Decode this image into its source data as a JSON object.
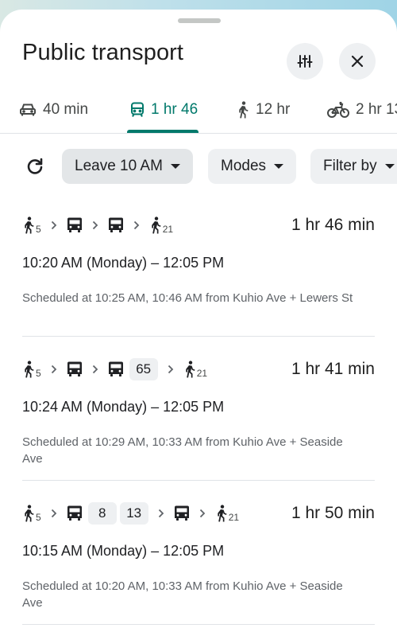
{
  "header": {
    "title": "Public transport",
    "settings_icon": "tune-sliders-icon",
    "close_icon": "close-icon"
  },
  "tabs": [
    {
      "mode": "car",
      "label": "40 min",
      "icon": "car-icon"
    },
    {
      "mode": "transit",
      "label": "1 hr 46",
      "icon": "transit-icon",
      "active": true
    },
    {
      "mode": "walk",
      "label": "12 hr",
      "icon": "walk-icon"
    },
    {
      "mode": "bike",
      "label": "2 hr 13",
      "icon": "bike-icon"
    }
  ],
  "filters": {
    "refresh_icon": "refresh-icon",
    "leave": "Leave 10 AM",
    "modes": "Modes",
    "filter_by": "Filter by"
  },
  "routes": [
    {
      "walk_start": "5",
      "bus_lines": [],
      "walk_end": "21",
      "duration": "1 hr 46 min",
      "times": "10:20 AM (Monday) – 12:05 PM",
      "schedule": "Scheduled at 10:25 AM, 10:46 AM from Kuhio Ave + Lewers St"
    },
    {
      "walk_start": "5",
      "bus_lines": [
        "65"
      ],
      "walk_end": "21",
      "duration": "1 hr 41 min",
      "times": "10:24 AM (Monday) – 12:05 PM",
      "schedule": "Scheduled at 10:29 AM, 10:33 AM from Kuhio Ave + Seaside Ave"
    },
    {
      "walk_start": "5",
      "bus_lines": [
        "8",
        "13"
      ],
      "walk_end": "21",
      "duration": "1 hr 50 min",
      "times": "10:15 AM (Monday) – 12:05 PM",
      "schedule": "Scheduled at 10:20 AM, 10:33 AM from Kuhio Ave + Seaside Ave"
    }
  ],
  "colors": {
    "accent": "#00796b",
    "chip_bg": "#eef0f2",
    "divider": "#e0e3e7"
  }
}
